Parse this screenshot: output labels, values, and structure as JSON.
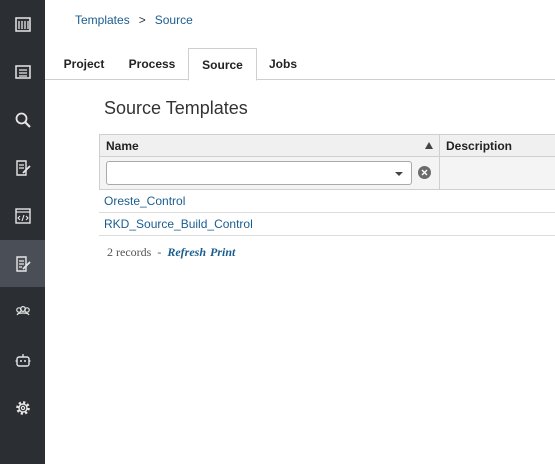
{
  "breadcrumb": {
    "root": "Templates",
    "separator": ">",
    "current": "Source"
  },
  "tabs": [
    {
      "label": "Project"
    },
    {
      "label": "Process"
    },
    {
      "label": "Source"
    },
    {
      "label": "Jobs"
    }
  ],
  "active_tab": "Source",
  "page_title": "Source Templates",
  "table": {
    "columns": [
      "Name",
      "Description"
    ],
    "sort": "Name ascending",
    "filter_value": "",
    "rows": [
      {
        "name": "Oreste_Control",
        "description": ""
      },
      {
        "name": "RKD_Source_Build_Control",
        "description": ""
      }
    ]
  },
  "footer": {
    "records": "2 records",
    "separator": "-",
    "refresh": "Refresh",
    "print": "Print"
  },
  "sidebar": {
    "items": [
      {
        "icon": "warehouse-icon"
      },
      {
        "icon": "list-icon"
      },
      {
        "icon": "search-icon"
      },
      {
        "icon": "edit-document-icon"
      },
      {
        "icon": "code-file-icon"
      },
      {
        "icon": "template-edit-icon",
        "active": true
      },
      {
        "icon": "team-icon"
      },
      {
        "icon": "robot-icon"
      },
      {
        "icon": "gear-icon"
      }
    ]
  },
  "colors": {
    "sidebar_bg": "#2b2e33",
    "sidebar_active": "#4a4f57",
    "link": "#1a5d8f"
  }
}
